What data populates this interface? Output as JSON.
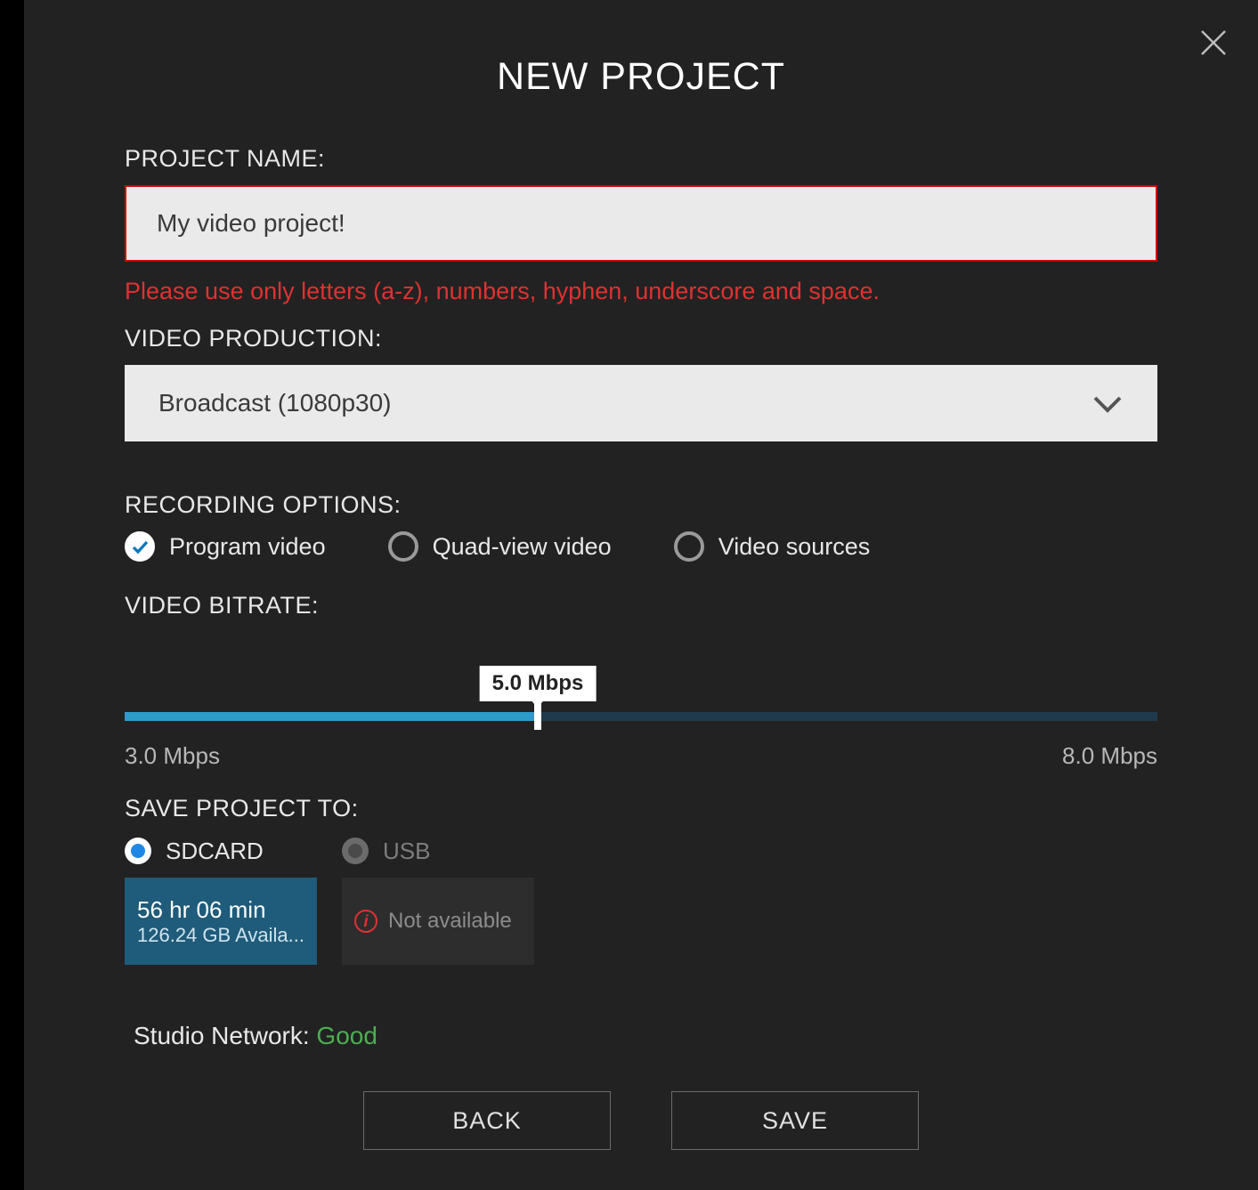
{
  "dialog": {
    "title": "NEW PROJECT"
  },
  "projectName": {
    "label": "PROJECT NAME:",
    "value": "My video project!",
    "error": "Please use only letters (a-z), numbers, hyphen, underscore and space."
  },
  "videoProduction": {
    "label": "VIDEO PRODUCTION:",
    "selected": "Broadcast (1080p30)"
  },
  "recording": {
    "label": "RECORDING OPTIONS:",
    "options": {
      "program": "Program video",
      "quad": "Quad-view video",
      "sources": "Video sources"
    }
  },
  "bitrate": {
    "label": "VIDEO BITRATE:",
    "value": "5.0 Mbps",
    "min": "3.0 Mbps",
    "max": "8.0 Mbps",
    "percent": 40
  },
  "saveTo": {
    "label": "SAVE PROJECT TO:",
    "sdcard": {
      "label": "SDCARD",
      "time": "56 hr 06 min",
      "available": "126.24 GB Availa..."
    },
    "usb": {
      "label": "USB",
      "status": "Not available"
    }
  },
  "network": {
    "label": "Studio Network: ",
    "status": "Good"
  },
  "buttons": {
    "back": "BACK",
    "save": "SAVE"
  }
}
